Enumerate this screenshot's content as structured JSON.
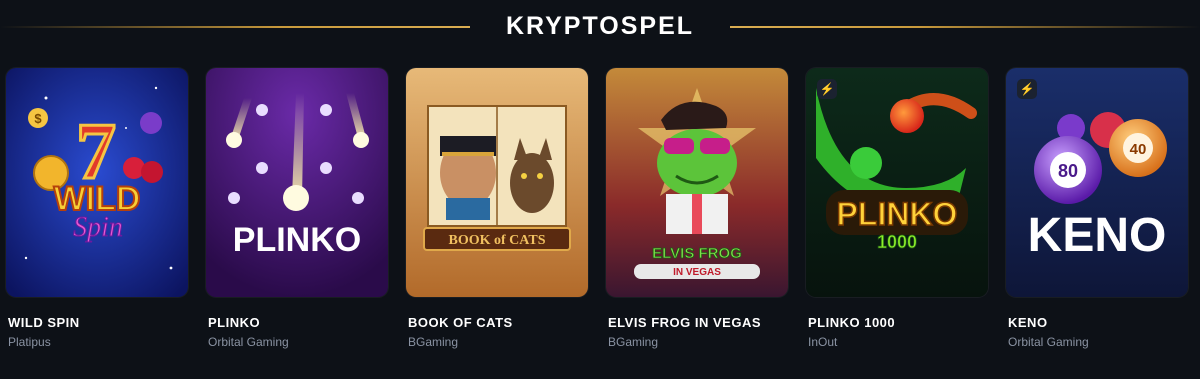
{
  "section": {
    "title": "KRYPTOSPEL"
  },
  "colors": {
    "background": "#0d1117",
    "accent_gold": "#c89a3c",
    "provider_text": "#8a93a3"
  },
  "games": [
    {
      "name": "WILD SPIN",
      "provider": "Platipus",
      "art_text": [
        "WILD",
        "Spin"
      ],
      "badge": null
    },
    {
      "name": "PLINKO",
      "provider": "Orbital Gaming",
      "art_text": [
        "PLINKO"
      ],
      "badge": null
    },
    {
      "name": "BOOK OF CATS",
      "provider": "BGaming",
      "art_text": [
        "BOOK of CATS"
      ],
      "badge": null
    },
    {
      "name": "ELVIS FROG IN VEGAS",
      "provider": "BGaming",
      "art_text": [
        "ELVIS FROG",
        "IN VEGAS"
      ],
      "badge": null
    },
    {
      "name": "PLINKO 1000",
      "provider": "InOut",
      "art_text": [
        "PLINKO",
        "1000"
      ],
      "badge": "lightning-icon"
    },
    {
      "name": "KENO",
      "provider": "Orbital Gaming",
      "art_text": [
        "KENO",
        "80",
        "40"
      ],
      "badge": "lightning-icon"
    }
  ]
}
